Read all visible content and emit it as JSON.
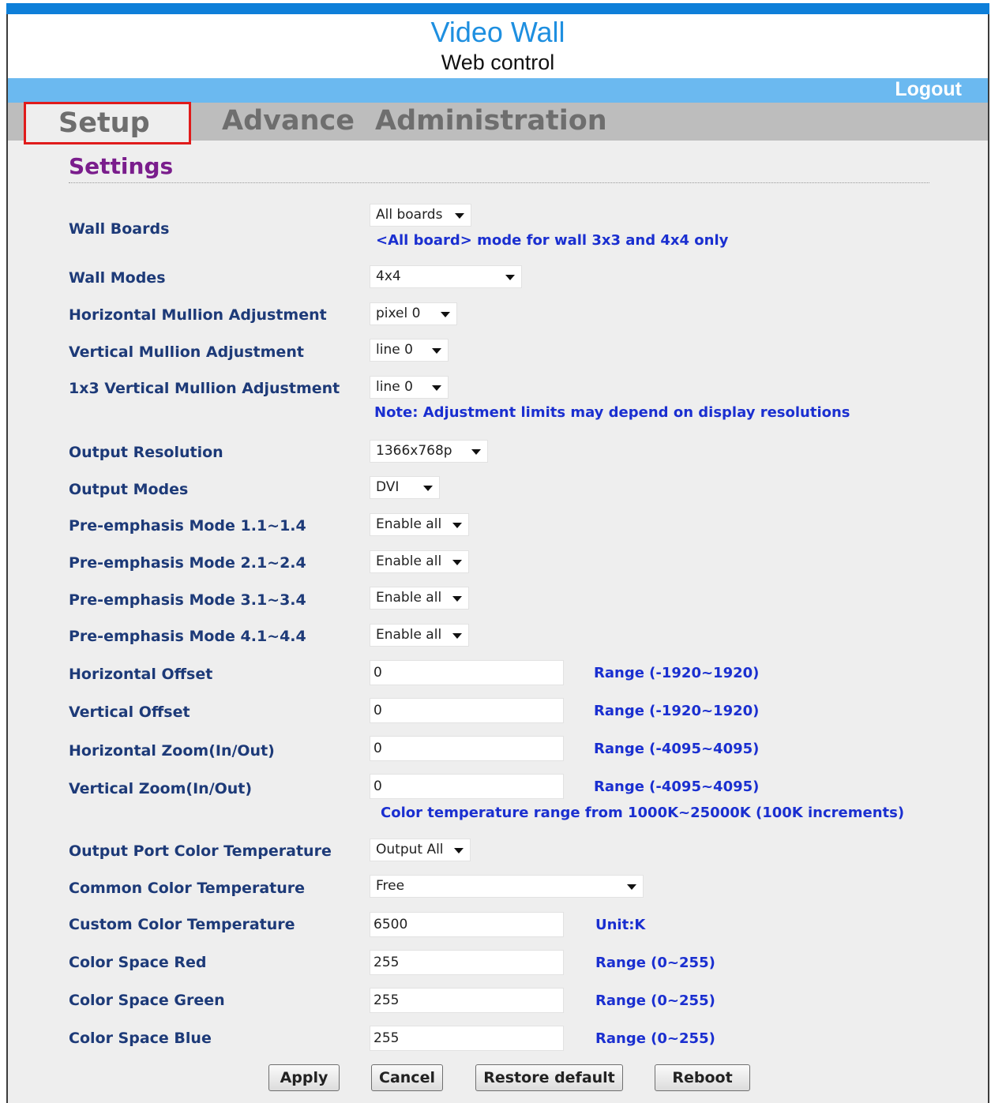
{
  "header": {
    "title": "Video Wall",
    "subtitle": "Web control",
    "logout": "Logout"
  },
  "tabs": {
    "setup": "Setup",
    "advance": "Advance",
    "administration": "Administration"
  },
  "section_title": "Settings",
  "fields": {
    "wall_boards": {
      "label": "Wall Boards",
      "value": "All boards"
    },
    "wall_boards_note": "<All board> mode for wall 3x3 and 4x4 only",
    "wall_modes": {
      "label": "Wall Modes",
      "value": "4x4"
    },
    "h_mullion": {
      "label": "Horizontal Mullion Adjustment",
      "value": "pixel 0"
    },
    "v_mullion": {
      "label": "Vertical Mullion Adjustment",
      "value": "line 0"
    },
    "v_mullion_1x3": {
      "label": "1x3 Vertical Mullion Adjustment",
      "value": "line 0"
    },
    "mullion_note": "Note: Adjustment limits may depend on display resolutions",
    "output_resolution": {
      "label": "Output Resolution",
      "value": "1366x768p"
    },
    "output_modes": {
      "label": "Output Modes",
      "value": "DVI"
    },
    "preemph_1": {
      "label": "Pre-emphasis Mode 1.1~1.4",
      "value": "Enable all"
    },
    "preemph_2": {
      "label": "Pre-emphasis Mode 2.1~2.4",
      "value": "Enable all"
    },
    "preemph_3": {
      "label": "Pre-emphasis Mode 3.1~3.4",
      "value": "Enable all"
    },
    "preemph_4": {
      "label": "Pre-emphasis Mode 4.1~4.4",
      "value": "Enable all"
    },
    "h_offset": {
      "label": "Horizontal Offset",
      "value": "0",
      "range": "Range (-1920~1920)"
    },
    "v_offset": {
      "label": "Vertical Offset",
      "value": "0",
      "range": "Range (-1920~1920)"
    },
    "h_zoom": {
      "label": "Horizontal Zoom(In/Out)",
      "value": "0",
      "range": "Range (-4095~4095)"
    },
    "v_zoom": {
      "label": "Vertical Zoom(In/Out)",
      "value": "0",
      "range": "Range (-4095~4095)"
    },
    "color_temp_note": "Color temperature range from 1000K~25000K (100K increments)",
    "output_port_ct": {
      "label": "Output Port Color Temperature",
      "value": "Output All"
    },
    "common_ct": {
      "label": "Common Color Temperature",
      "value": "Free"
    },
    "custom_ct": {
      "label": "Custom Color Temperature",
      "value": "6500",
      "unit": "Unit:K"
    },
    "cs_red": {
      "label": "Color Space Red",
      "value": "255",
      "range": "Range (0~255)"
    },
    "cs_green": {
      "label": "Color Space Green",
      "value": "255",
      "range": "Range (0~255)"
    },
    "cs_blue": {
      "label": "Color Space Blue",
      "value": "255",
      "range": "Range (0~255)"
    }
  },
  "buttons": {
    "apply": "Apply",
    "cancel": "Cancel",
    "restore": "Restore default",
    "reboot": "Reboot"
  },
  "colors": {
    "accent_blue": "#1e8fe0",
    "bar_blue": "#6bb9f0",
    "label_navy": "#1d3a78",
    "note_blue": "#1a2fd0",
    "title_purple": "#7a1d8c",
    "highlight_red": "#e01b1b"
  }
}
